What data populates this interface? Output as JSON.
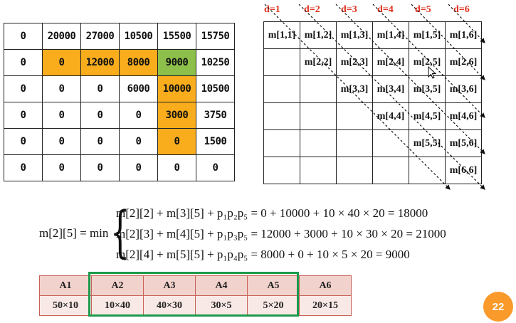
{
  "dp_table": {
    "rows": [
      [
        "0",
        "20000",
        "27000",
        "10500",
        "15500",
        "15750"
      ],
      [
        "0",
        "0",
        "12000",
        "8000",
        "9000",
        "10250"
      ],
      [
        "0",
        "0",
        "0",
        "6000",
        "10000",
        "10500"
      ],
      [
        "0",
        "0",
        "0",
        "0",
        "3000",
        "3750"
      ],
      [
        "0",
        "0",
        "0",
        "0",
        "0",
        "1500"
      ],
      [
        "0",
        "0",
        "0",
        "0",
        "0",
        "0"
      ]
    ],
    "highlight_orange_color": "#f9ad1c",
    "highlight_green_color": "#8dc04a"
  },
  "structure_table": {
    "diagonal_labels": [
      "d=1",
      "d=2",
      "d=3",
      "d=4",
      "d=5",
      "d=6"
    ],
    "label_color": "#e0301e",
    "rows": [
      [
        "m[1,1]",
        "m[1,2]",
        "m[1,3]",
        "m[1,4]",
        "m[1,5]",
        "m[1,6]"
      ],
      [
        "",
        "m[2,2]",
        "m[2,3]",
        "m[2,4]",
        "m[2,5]",
        "m[2,6]"
      ],
      [
        "",
        "",
        "m[3,3]",
        "m[3,4]",
        "m[3,5]",
        "m[3,6]"
      ],
      [
        "",
        "",
        "",
        "m[4,4]",
        "m[4,5]",
        "m[4,6]"
      ],
      [
        "",
        "",
        "",
        "",
        "m[5,5]",
        "m[5,6]"
      ],
      [
        "",
        "",
        "",
        "",
        "",
        "m[6,6]"
      ]
    ]
  },
  "formula": {
    "lhs": "m[2][5] = min",
    "lines": [
      "m[2][2] + m[3][5] + p₁p₂p₅ = 0 + 10000 + 10 × 40 × 20 = 18000",
      "m[2][3] + m[4][5] + p₁p₃p₅ = 12000 + 3000 + 10 × 30 × 20 = 21000",
      "m[2][4] + m[5][5] + p₁p₄p₅ = 8000 + 0 + 10 × 5 × 20 = 9000"
    ]
  },
  "matrices": {
    "names": [
      "A1",
      "A2",
      "A3",
      "A4",
      "A5",
      "A6"
    ],
    "dims": [
      "50×10",
      "10×40",
      "40×30",
      "30×5",
      "5×20",
      "20×15"
    ],
    "highlight_border_color": "#1c9a4c"
  },
  "page_number": "22"
}
